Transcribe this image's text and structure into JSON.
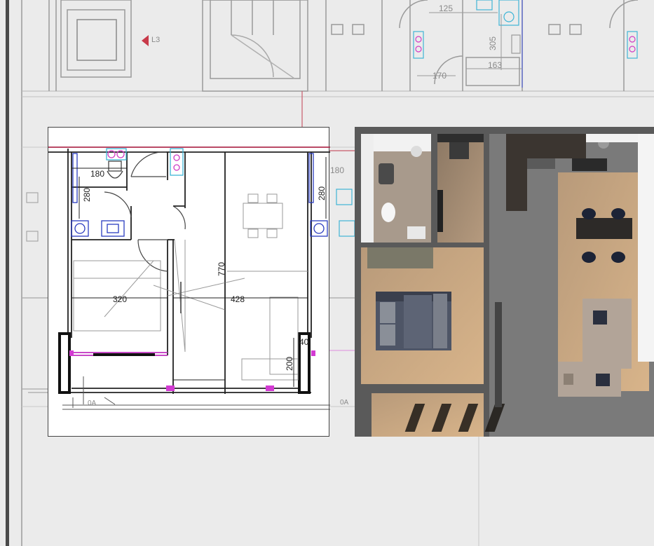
{
  "background_plan": {
    "level_marker": "L3",
    "dimensions": {
      "top_width": "125",
      "top_height": "305",
      "top_width_2": "163",
      "top_width_3": "170",
      "left_neighbor_width": "180",
      "right_neighbor_height": "280"
    }
  },
  "floor_plan": {
    "dimensions": {
      "bathroom_width": "180",
      "bathroom_depth": "280",
      "right_depth": "280",
      "bedroom_width": "320",
      "living_width": "428",
      "unit_depth": "770",
      "wall_40": "40",
      "balcony_200": "200"
    },
    "door_tag": "0A",
    "door_tag_right": "0A"
  },
  "render_3d": {
    "floor_color": "#c9a47a",
    "wall_color": "#5a5a5a"
  }
}
